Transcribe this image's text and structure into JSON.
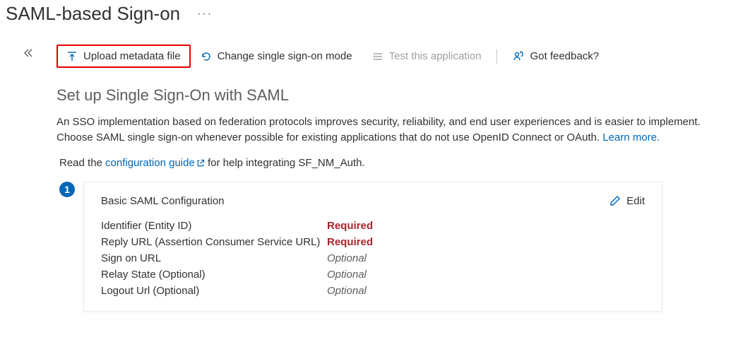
{
  "header": {
    "title": "SAML-based Sign-on"
  },
  "toolbar": {
    "upload": "Upload metadata file",
    "change_mode": "Change single sign-on mode",
    "test_app": "Test this application",
    "feedback": "Got feedback?"
  },
  "section": {
    "heading": "Set up Single Sign-On with SAML",
    "description_a": "An SSO implementation based on federation protocols improves security, reliability, and end user experiences and is easier to implement. Choose SAML single sign-on whenever possible for existing applications that do not use OpenID Connect or OAuth. ",
    "learn_more": "Learn more.",
    "guide_prefix": "Read the ",
    "guide_link": "configuration guide",
    "guide_suffix": " for help integrating SF_NM_Auth."
  },
  "card": {
    "step": "1",
    "title": "Basic SAML Configuration",
    "edit": "Edit",
    "rows": [
      {
        "label": "Identifier (Entity ID)",
        "value": "Required",
        "kind": "required"
      },
      {
        "label": "Reply URL (Assertion Consumer Service URL)",
        "value": "Required",
        "kind": "required"
      },
      {
        "label": "Sign on URL",
        "value": "Optional",
        "kind": "optional"
      },
      {
        "label": "Relay State (Optional)",
        "value": "Optional",
        "kind": "optional"
      },
      {
        "label": "Logout Url (Optional)",
        "value": "Optional",
        "kind": "optional"
      }
    ]
  }
}
